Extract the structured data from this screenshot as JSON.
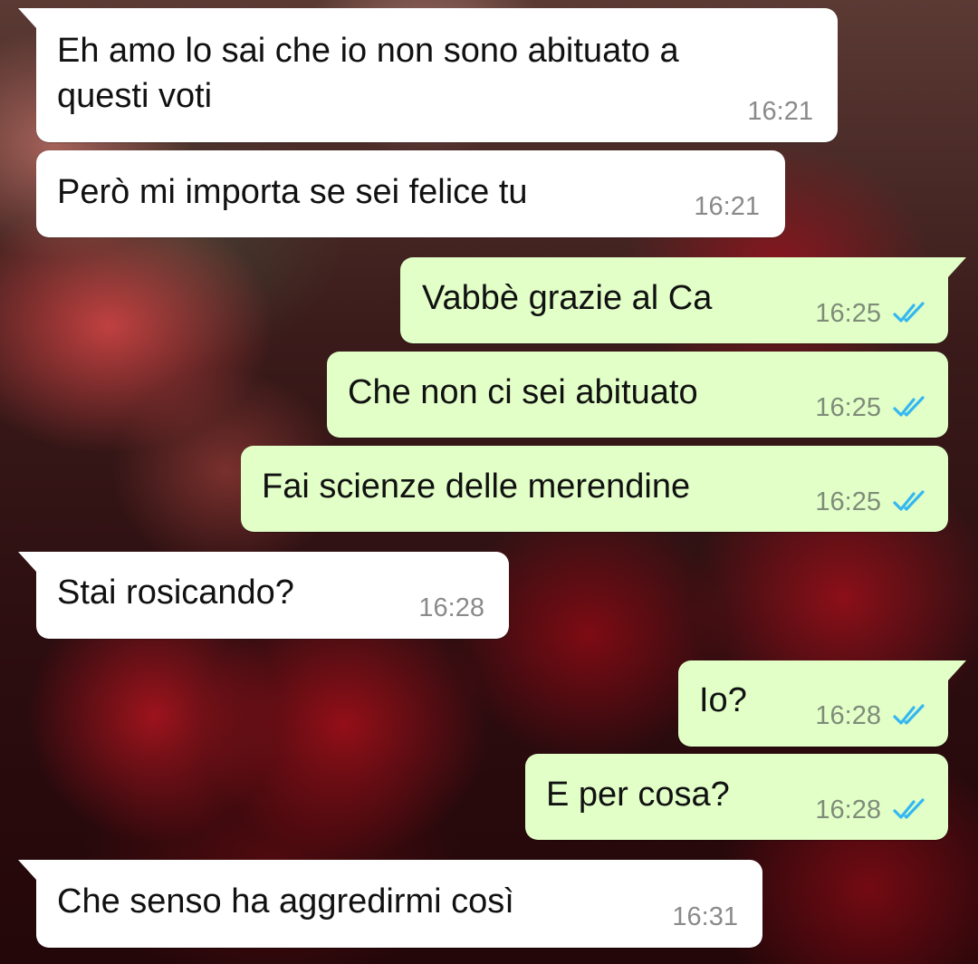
{
  "theme": {
    "incoming_bubble": "#ffffff",
    "outgoing_bubble": "#e1ffc7",
    "read_ticks_color": "#34b7f1"
  },
  "messages": [
    {
      "direction": "incoming",
      "text": "Eh amo lo sai che io non sono abituato a\nquesti voti",
      "time": "16:21"
    },
    {
      "direction": "incoming",
      "text": "Però mi importa se sei felice tu",
      "time": "16:21"
    },
    {
      "direction": "outgoing",
      "text": "Vabbè grazie al Ca",
      "time": "16:25",
      "status": "read-double-tick-icon"
    },
    {
      "direction": "outgoing",
      "text": "Che non ci sei abituato",
      "time": "16:25",
      "status": "read-double-tick-icon"
    },
    {
      "direction": "outgoing",
      "text": "Fai scienze delle merendine",
      "time": "16:25",
      "status": "read-double-tick-icon"
    },
    {
      "direction": "incoming",
      "text": "Stai rosicando?",
      "time": "16:28"
    },
    {
      "direction": "outgoing",
      "text": "Io?",
      "time": "16:28",
      "status": "read-double-tick-icon"
    },
    {
      "direction": "outgoing",
      "text": "E per cosa?",
      "time": "16:28",
      "status": "read-double-tick-icon"
    },
    {
      "direction": "incoming",
      "text": "Che senso ha aggredirmi così",
      "time": "16:31"
    }
  ]
}
